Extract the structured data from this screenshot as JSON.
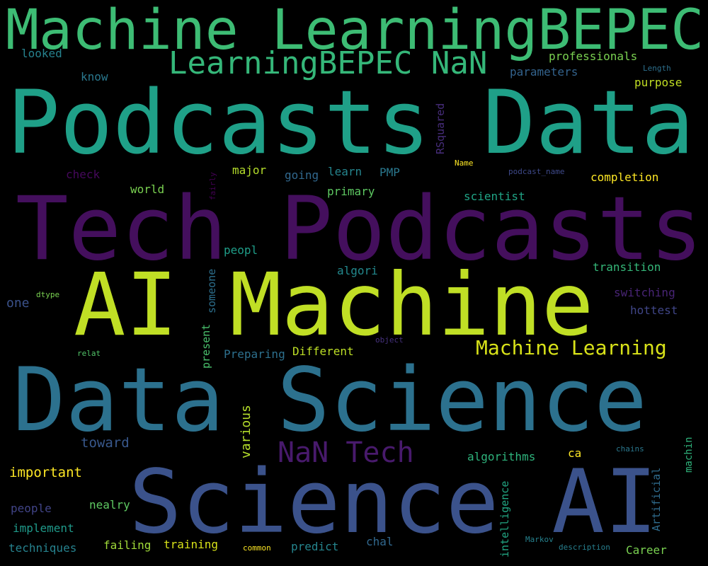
{
  "words": [
    {
      "id": "machine-learning-bepec",
      "text": "Machine LearningBEPEC",
      "color": "#3dbc74"
    },
    {
      "id": "learning-bepec-nan",
      "text": "LearningBEPEC NaN",
      "color": "#35b779"
    },
    {
      "id": "podcasts-data",
      "text": "Podcasts Data",
      "color": "#1fa088"
    },
    {
      "id": "tech-podcasts",
      "text": "Tech Podcasts",
      "color": "#440f5d"
    },
    {
      "id": "ai-machine",
      "text": "AI Machine",
      "color": "#c0df25"
    },
    {
      "id": "data-science",
      "text": "Data Science",
      "color": "#2c718e"
    },
    {
      "id": "science-ai",
      "text": "Science AI",
      "color": "#3b528b"
    },
    {
      "id": "machine-learning",
      "text": "Machine Learning",
      "color": "#d8e219"
    },
    {
      "id": "nan-tech",
      "text": "NaN Tech",
      "color": "#481a6c"
    },
    {
      "id": "looked",
      "text": "looked",
      "color": "#26828e"
    },
    {
      "id": "know",
      "text": "know",
      "color": "#2a788e"
    },
    {
      "id": "professionals",
      "text": "professionals",
      "color": "#7ad151"
    },
    {
      "id": "parameters",
      "text": "parameters",
      "color": "#33638d"
    },
    {
      "id": "length",
      "text": "Length",
      "color": "#2d708e"
    },
    {
      "id": "purpose",
      "text": "purpose",
      "color": "#c2df23"
    },
    {
      "id": "rsquared",
      "text": "RSquared",
      "color": "#472d7b"
    },
    {
      "id": "name",
      "text": "Name",
      "color": "#fde725"
    },
    {
      "id": "check",
      "text": "check",
      "color": "#46085c"
    },
    {
      "id": "major",
      "text": "major",
      "color": "#b5de2b"
    },
    {
      "id": "going",
      "text": "going",
      "color": "#31688e"
    },
    {
      "id": "learn",
      "text": "learn",
      "color": "#25858e"
    },
    {
      "id": "pmp",
      "text": "PMP",
      "color": "#2a788e"
    },
    {
      "id": "podcast-name",
      "text": "podcast_name",
      "color": "#3e4989"
    },
    {
      "id": "completion",
      "text": "completion",
      "color": "#fde725"
    },
    {
      "id": "world",
      "text": "world",
      "color": "#7ad151"
    },
    {
      "id": "fairly",
      "text": "fairly",
      "color": "#440154"
    },
    {
      "id": "primary",
      "text": "primary",
      "color": "#5ec962"
    },
    {
      "id": "scientist",
      "text": "scientist",
      "color": "#20a486"
    },
    {
      "id": "peopl",
      "text": "peopl",
      "color": "#1f9e89"
    },
    {
      "id": "someone",
      "text": "someone",
      "color": "#2d708e"
    },
    {
      "id": "algori",
      "text": "algori",
      "color": "#23898e"
    },
    {
      "id": "transition",
      "text": "transition",
      "color": "#35b779"
    },
    {
      "id": "switching",
      "text": "switching",
      "color": "#482475"
    },
    {
      "id": "one",
      "text": "one",
      "color": "#3b528b"
    },
    {
      "id": "dtype",
      "text": "dtype",
      "color": "#7ad151"
    },
    {
      "id": "hottest",
      "text": "hottest",
      "color": "#404688"
    },
    {
      "id": "present",
      "text": "present",
      "color": "#4ac16d"
    },
    {
      "id": "preparing",
      "text": "Preparing",
      "color": "#2d708e"
    },
    {
      "id": "different",
      "text": "Different",
      "color": "#bddf26"
    },
    {
      "id": "object",
      "text": "object",
      "color": "#46327e"
    },
    {
      "id": "relat",
      "text": "relat",
      "color": "#52c569"
    },
    {
      "id": "various",
      "text": "various",
      "color": "#b5de2b"
    },
    {
      "id": "toward",
      "text": "toward",
      "color": "#38588c"
    },
    {
      "id": "chains",
      "text": "chains",
      "color": "#2a788e"
    },
    {
      "id": "machin",
      "text": "machin",
      "color": "#2fb47c"
    },
    {
      "id": "important",
      "text": "important",
      "color": "#fde725"
    },
    {
      "id": "algorithms",
      "text": "algorithms",
      "color": "#2eb37c"
    },
    {
      "id": "ca",
      "text": "ca",
      "color": "#fde725"
    },
    {
      "id": "artificial",
      "text": "Artificial",
      "color": "#2f6c8e"
    },
    {
      "id": "people",
      "text": "people",
      "color": "#414487"
    },
    {
      "id": "nealry",
      "text": "nealry",
      "color": "#5ec962"
    },
    {
      "id": "implement",
      "text": "implement",
      "color": "#1f9a8a"
    },
    {
      "id": "intelligence",
      "text": "intelligence",
      "color": "#22a884"
    },
    {
      "id": "chal",
      "text": "chal",
      "color": "#31688e"
    },
    {
      "id": "markov",
      "text": "Markov",
      "color": "#26828e"
    },
    {
      "id": "techniques",
      "text": "techniques",
      "color": "#26828e"
    },
    {
      "id": "failing",
      "text": "failing",
      "color": "#a0da39"
    },
    {
      "id": "training",
      "text": "training",
      "color": "#d8e219"
    },
    {
      "id": "common",
      "text": "common",
      "color": "#fde725"
    },
    {
      "id": "predict",
      "text": "predict",
      "color": "#25858e"
    },
    {
      "id": "description",
      "text": "description",
      "color": "#277f8e"
    },
    {
      "id": "career",
      "text": "Career",
      "color": "#7ad151"
    }
  ]
}
